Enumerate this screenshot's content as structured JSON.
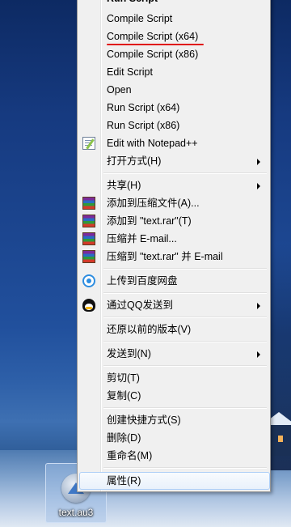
{
  "desktop": {
    "icon_label": "text.au3"
  },
  "menu": {
    "items": [
      {
        "label": "Run Script",
        "bold": true
      },
      {
        "label": "Compile Script"
      },
      {
        "label": "Compile Script (x64)",
        "annotation": "red-underline"
      },
      {
        "label": "Compile Script (x86)"
      },
      {
        "label": "Edit Script"
      },
      {
        "label": "Open"
      },
      {
        "label": "Run Script (x64)"
      },
      {
        "label": "Run Script (x86)"
      },
      {
        "label": "Edit with Notepad++",
        "icon": "notepad-plus-icon"
      },
      {
        "label": "打开方式(H)",
        "submenu": true
      },
      {
        "label": "共享(H)",
        "submenu": true
      },
      {
        "label": "添加到压缩文件(A)...",
        "icon": "winrar-icon"
      },
      {
        "label": "添加到 \"text.rar\"(T)",
        "icon": "winrar-icon"
      },
      {
        "label": "压缩并 E-mail...",
        "icon": "winrar-icon"
      },
      {
        "label": "压缩到 \"text.rar\" 并 E-mail",
        "icon": "winrar-icon"
      },
      {
        "label": "上传到百度网盘",
        "icon": "baidu-netdisk-icon"
      },
      {
        "label": "通过QQ发送到",
        "icon": "qq-icon",
        "submenu": true
      },
      {
        "label": "还原以前的版本(V)"
      },
      {
        "label": "发送到(N)",
        "submenu": true
      },
      {
        "label": "剪切(T)"
      },
      {
        "label": "复制(C)"
      },
      {
        "label": "创建快捷方式(S)"
      },
      {
        "label": "删除(D)"
      },
      {
        "label": "重命名(M)"
      },
      {
        "label": "属性(R)",
        "highlighted": true
      }
    ]
  },
  "colors": {
    "menu_bg": "#f0f0f0",
    "highlight_border": "#aecff7",
    "annotation_red": "#e01010"
  }
}
